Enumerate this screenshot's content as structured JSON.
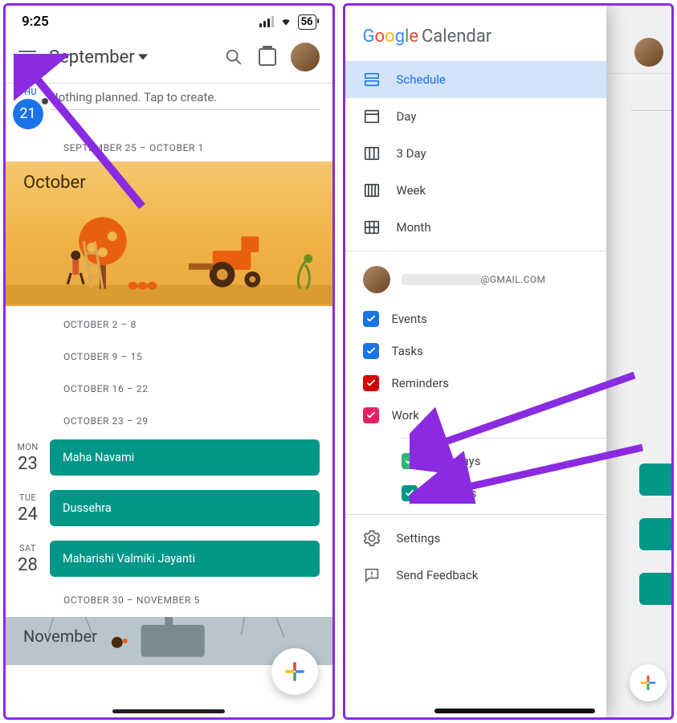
{
  "status": {
    "time": "9:25",
    "battery": "56"
  },
  "header": {
    "month": "September"
  },
  "today": {
    "dow": "THU",
    "day": "21",
    "nothing": "Nothing planned. Tap to create."
  },
  "weeks": [
    "SEPTEMBER 25 – OCTOBER 1",
    "OCTOBER 2 – 8",
    "OCTOBER 9 – 15",
    "OCTOBER 16 – 22",
    "OCTOBER 23 – 29",
    "OCTOBER 30 – NOVEMBER 5"
  ],
  "october_title": "October",
  "november_title": "November",
  "events": [
    {
      "dow": "MON",
      "day": "23",
      "title": "Maha Navami"
    },
    {
      "dow": "TUE",
      "day": "24",
      "title": "Dussehra"
    },
    {
      "dow": "SAT",
      "day": "28",
      "title": "Maharishi Valmiki Jayanti"
    }
  ],
  "drawer": {
    "logo_suffix": "Calendar",
    "views": [
      {
        "label": "Schedule",
        "selected": true
      },
      {
        "label": "Day"
      },
      {
        "label": "3 Day"
      },
      {
        "label": "Week"
      },
      {
        "label": "Month"
      }
    ],
    "account_suffix": "@GMAIL.COM",
    "calendars": [
      {
        "label": "Events",
        "color": "#1a73e8"
      },
      {
        "label": "Tasks",
        "color": "#1a73e8"
      },
      {
        "label": "Reminders",
        "color": "#d50000"
      },
      {
        "label": "Work",
        "color": "#e91e63"
      }
    ],
    "other_calendars": [
      {
        "label": "Birthdays",
        "color": "#33b679"
      },
      {
        "label": "Holidays",
        "color": "#009688"
      }
    ],
    "settings": "Settings",
    "feedback": "Send Feedback"
  }
}
